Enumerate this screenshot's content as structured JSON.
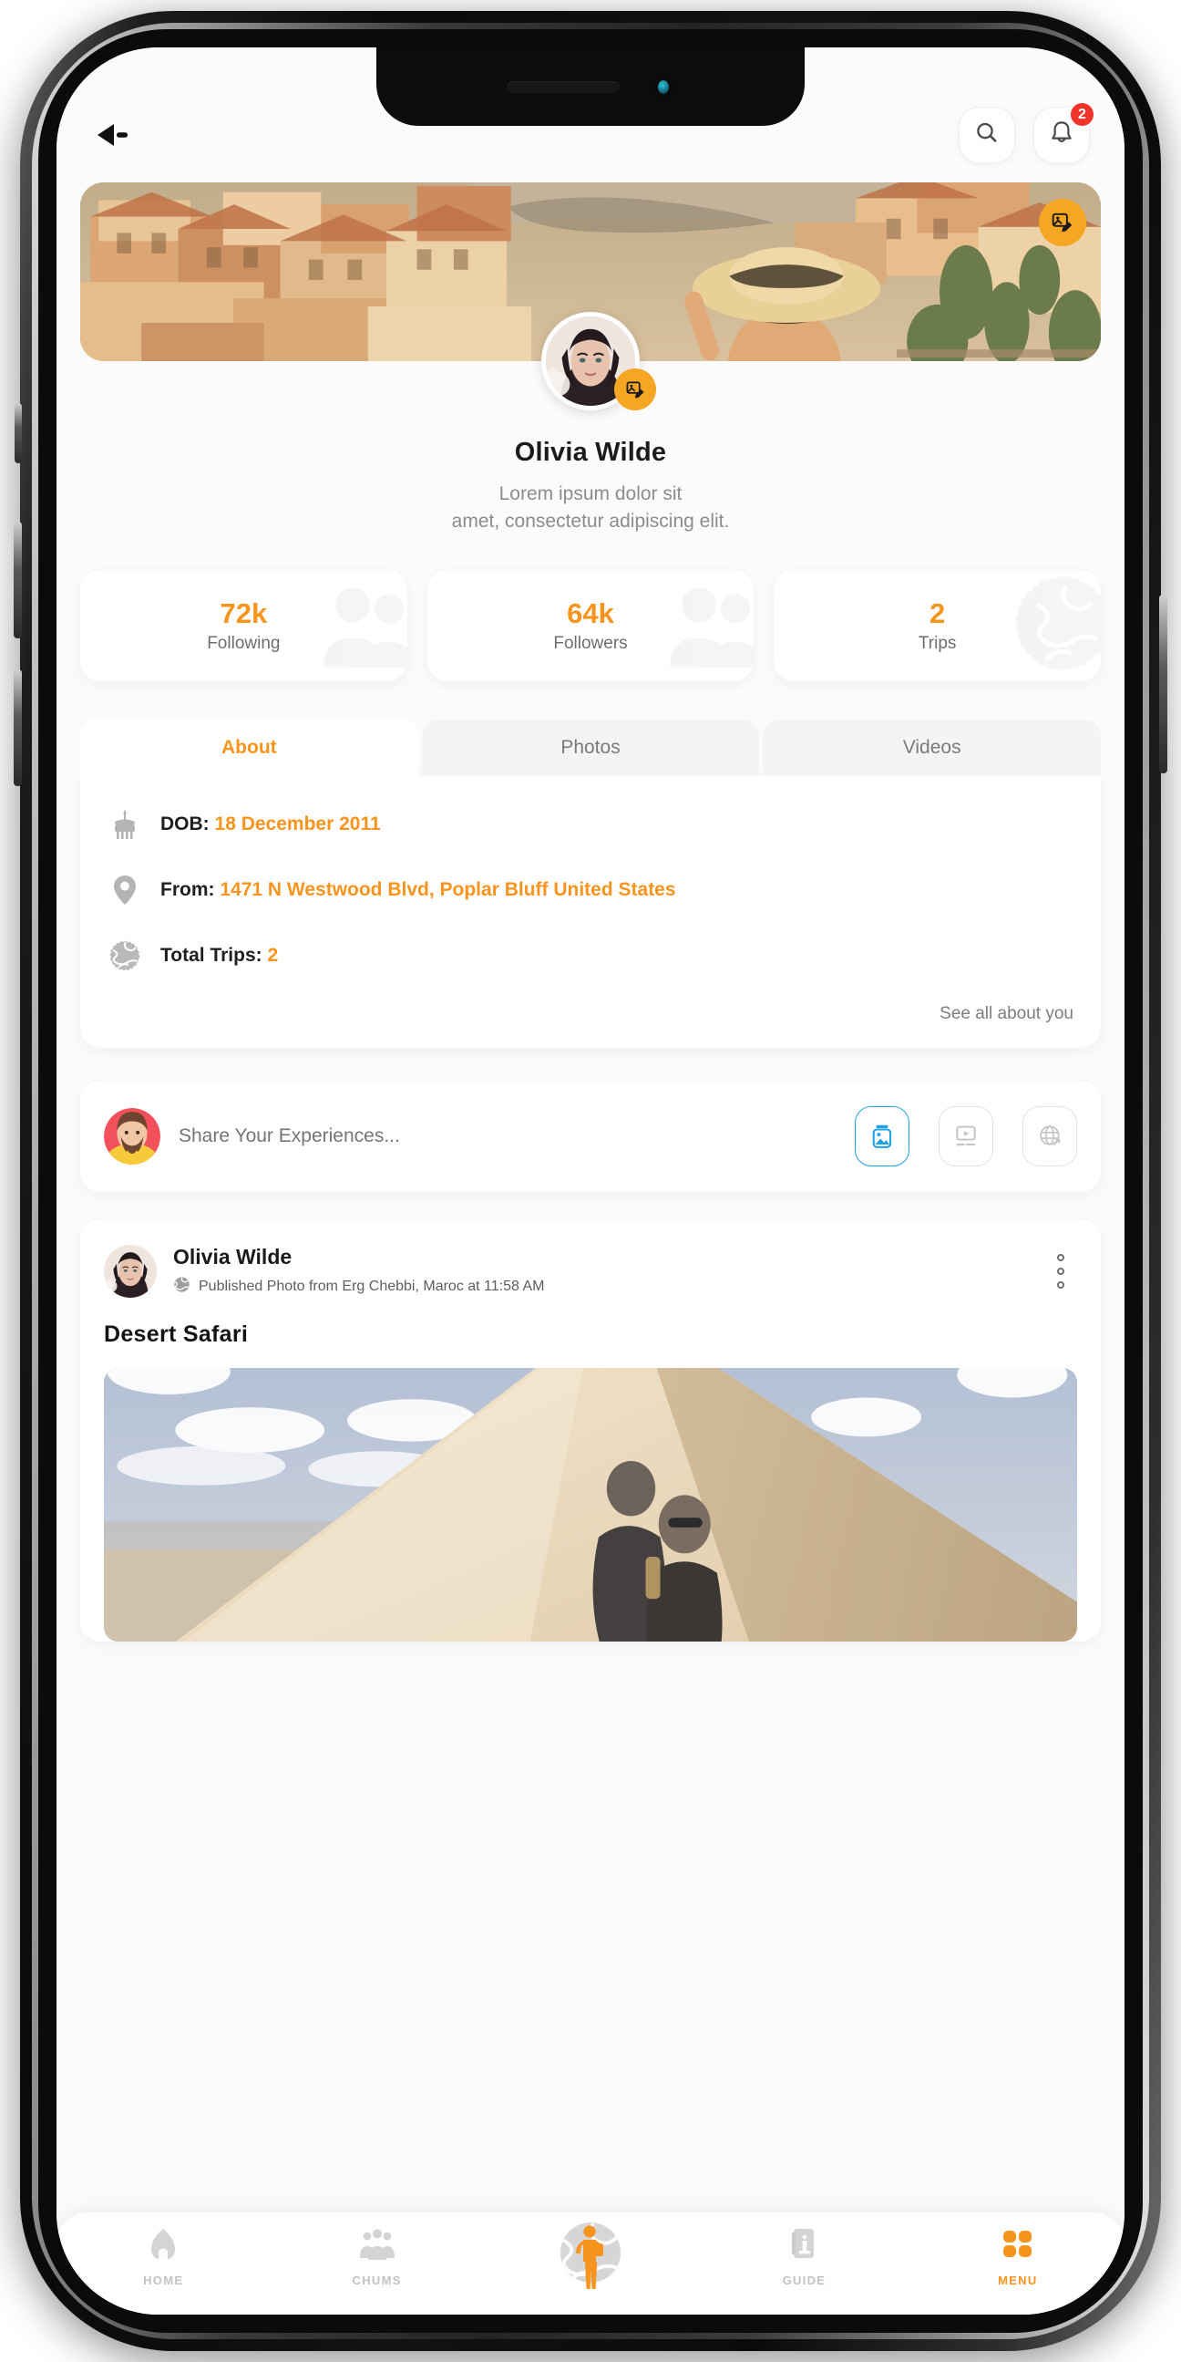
{
  "topbar": {
    "back_icon": "back-arrow-icon",
    "search_icon": "search-icon",
    "bell_icon": "bell-icon",
    "notification_count": "2"
  },
  "cover": {
    "edit_icon": "edit-photo-icon",
    "alt": "coastal village cover photo"
  },
  "avatar": {
    "edit_icon": "edit-photo-icon",
    "alt": "profile avatar"
  },
  "profile": {
    "name": "Olivia Wilde",
    "bio_line1": "Lorem ipsum dolor sit",
    "bio_line2": "amet, consectetur adipiscing elit."
  },
  "stats": [
    {
      "value": "72k",
      "label": "Following",
      "watermark": "people-icon"
    },
    {
      "value": "64k",
      "label": "Followers",
      "watermark": "people-icon"
    },
    {
      "value": "2",
      "label": "Trips",
      "watermark": "globe-icon"
    }
  ],
  "tabs": [
    {
      "label": "About",
      "active": true
    },
    {
      "label": "Photos",
      "active": false
    },
    {
      "label": "Videos",
      "active": false
    }
  ],
  "about": {
    "rows": [
      {
        "icon": "birthday-cake-icon",
        "label": "DOB:",
        "value": "18 December 2011"
      },
      {
        "icon": "location-pin-icon",
        "label": "From:",
        "value": "1471 N Westwood Blvd, Poplar Bluff United States"
      },
      {
        "icon": "globe-icon",
        "label": "Total Trips:",
        "value": "2"
      }
    ],
    "see_all": "See all about you"
  },
  "composer": {
    "placeholder": "Share Your Experiences...",
    "buttons": [
      {
        "icon": "image-icon",
        "active": true
      },
      {
        "icon": "video-icon",
        "active": false
      },
      {
        "icon": "globe-travel-icon",
        "active": false
      }
    ]
  },
  "post": {
    "author": "Olivia Wilde",
    "meta_icon": "globe-small-icon",
    "meta": "Published Photo from Erg Chebbi, Maroc at 11:58 AM",
    "menu_icon": "kebab-menu-icon",
    "title": "Desert Safari",
    "image_alt": "two people sitting on a desert sand dune"
  },
  "bottomnav": [
    {
      "label": "HOME",
      "icon": "home-icon",
      "active": false
    },
    {
      "label": "CHUMS",
      "icon": "people-group-icon",
      "active": false
    },
    {
      "label": "",
      "icon": "traveler-globe-icon",
      "active": false,
      "center": true
    },
    {
      "label": "GUIDE",
      "icon": "info-book-icon",
      "active": false
    },
    {
      "label": "MENU",
      "icon": "grid-menu-icon",
      "active": true
    }
  ],
  "colors": {
    "accent": "#f7941d",
    "edit_fab": "#f5a623",
    "badge": "#f0342c",
    "composer_active": "#1ea0e6",
    "muted": "#8c8c8c"
  }
}
